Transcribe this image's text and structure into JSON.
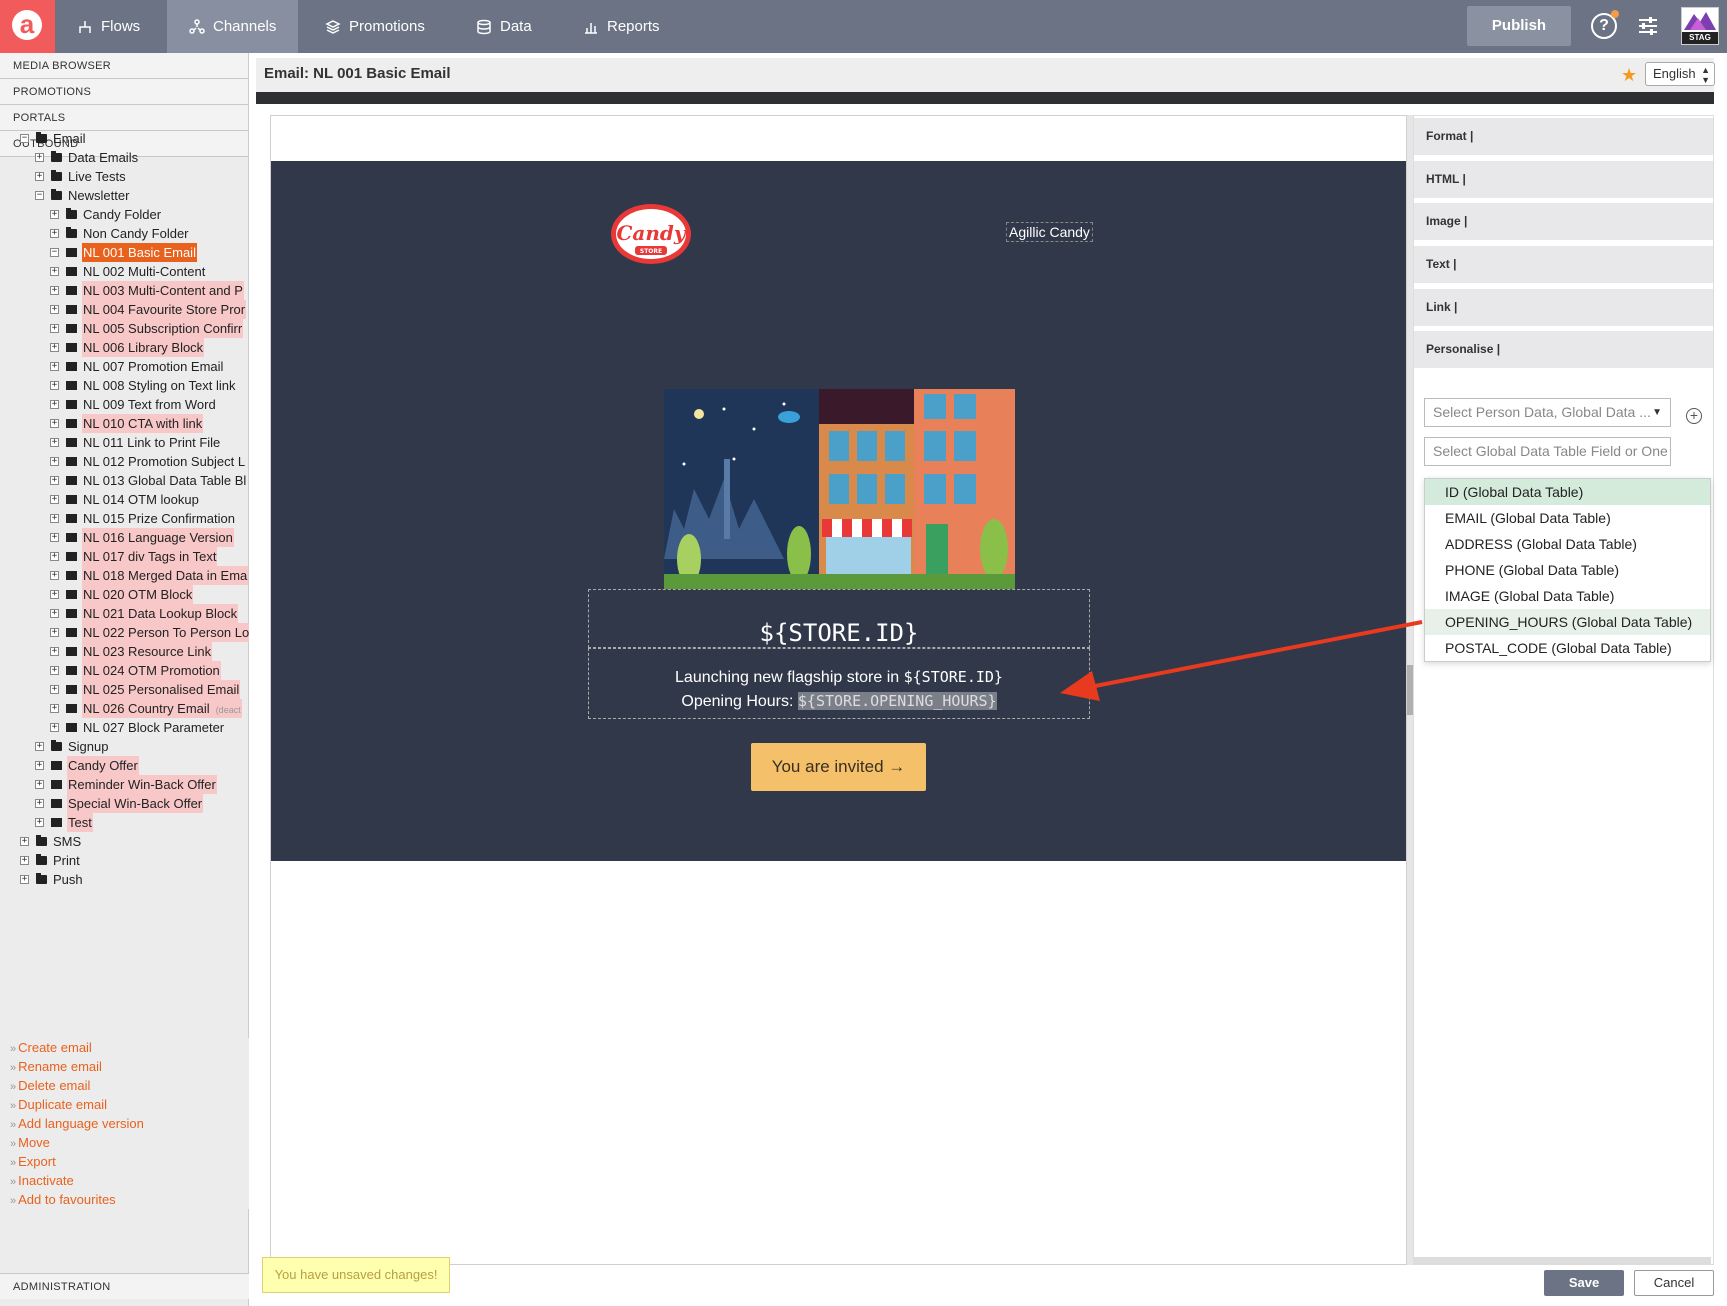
{
  "nav": {
    "items": [
      {
        "label": "Flows",
        "icon": "flows-icon"
      },
      {
        "label": "Channels",
        "icon": "channels-icon",
        "active": true
      },
      {
        "label": "Promotions",
        "icon": "promotions-icon"
      },
      {
        "label": "Data",
        "icon": "data-icon"
      },
      {
        "label": "Reports",
        "icon": "reports-icon"
      }
    ],
    "publish_label": "Publish",
    "help_label": "?",
    "env_label": "STAG"
  },
  "sidebar": {
    "sections": [
      "MEDIA BROWSER",
      "PROMOTIONS",
      "PORTALS",
      "OUTBOUND"
    ],
    "tree": [
      {
        "label": "Email",
        "level": 0,
        "type": "folder",
        "toggle": "−"
      },
      {
        "label": "Data Emails",
        "level": 1,
        "type": "folder",
        "toggle": "+"
      },
      {
        "label": "Live Tests",
        "level": 1,
        "type": "folder",
        "toggle": "+"
      },
      {
        "label": "Newsletter",
        "level": 1,
        "type": "folder",
        "toggle": "−"
      },
      {
        "label": "Candy Folder",
        "level": 2,
        "type": "folder",
        "toggle": "+"
      },
      {
        "label": "Non Candy Folder",
        "level": 2,
        "type": "folder",
        "toggle": "+"
      },
      {
        "label": "NL 001 Basic Email",
        "level": 2,
        "type": "mail",
        "toggle": "−",
        "state": "selected"
      },
      {
        "label": "NL 002 Multi-Content",
        "level": 2,
        "type": "mail",
        "toggle": "+"
      },
      {
        "label": "NL 003 Multi-Content and P",
        "level": 2,
        "type": "mail",
        "toggle": "+",
        "state": "pink"
      },
      {
        "label": "NL 004 Favourite Store Pror",
        "level": 2,
        "type": "mail",
        "toggle": "+",
        "state": "pink"
      },
      {
        "label": "NL 005 Subscription Confirr",
        "level": 2,
        "type": "mail",
        "toggle": "+",
        "state": "pink"
      },
      {
        "label": "NL 006 Library Block",
        "level": 2,
        "type": "mail",
        "toggle": "+",
        "state": "pink"
      },
      {
        "label": "NL 007 Promotion Email",
        "level": 2,
        "type": "mail",
        "toggle": "+"
      },
      {
        "label": "NL 008 Styling on Text link",
        "level": 2,
        "type": "mail",
        "toggle": "+"
      },
      {
        "label": "NL 009 Text from Word",
        "level": 2,
        "type": "mail",
        "toggle": "+"
      },
      {
        "label": "NL 010 CTA with link",
        "level": 2,
        "type": "mail",
        "toggle": "+",
        "state": "pink"
      },
      {
        "label": "NL 011 Link to Print File",
        "level": 2,
        "type": "mail",
        "toggle": "+"
      },
      {
        "label": "NL 012 Promotion Subject L",
        "level": 2,
        "type": "mail",
        "toggle": "+"
      },
      {
        "label": "NL 013 Global Data Table Bl",
        "level": 2,
        "type": "mail",
        "toggle": "+"
      },
      {
        "label": "NL 014 OTM lookup",
        "level": 2,
        "type": "mail",
        "toggle": "+"
      },
      {
        "label": "NL 015 Prize Confirmation",
        "level": 2,
        "type": "mail",
        "toggle": "+"
      },
      {
        "label": "NL 016 Language Version",
        "level": 2,
        "type": "mail",
        "toggle": "+",
        "state": "pink"
      },
      {
        "label": "NL 017 div Tags in Text",
        "level": 2,
        "type": "mail",
        "toggle": "+",
        "state": "pink"
      },
      {
        "label": "NL 018 Merged Data in Ema",
        "level": 2,
        "type": "mail",
        "toggle": "+",
        "state": "pink"
      },
      {
        "label": "NL 020 OTM Block",
        "level": 2,
        "type": "mail",
        "toggle": "+",
        "state": "pink"
      },
      {
        "label": "NL 021 Data Lookup Block",
        "level": 2,
        "type": "mail",
        "toggle": "+",
        "state": "pink"
      },
      {
        "label": "NL 022 Person To Person Lo",
        "level": 2,
        "type": "mail",
        "toggle": "+",
        "state": "pink"
      },
      {
        "label": "NL 023 Resource Link",
        "level": 2,
        "type": "mail",
        "toggle": "+",
        "state": "pink"
      },
      {
        "label": "NL 024 OTM Promotion",
        "level": 2,
        "type": "mail",
        "toggle": "+",
        "state": "pink"
      },
      {
        "label": "NL 025 Personalised Email",
        "level": 2,
        "type": "mail",
        "toggle": "+",
        "state": "pink"
      },
      {
        "label": "NL 026 Country Email",
        "level": 2,
        "type": "mail",
        "toggle": "+",
        "state": "pink",
        "suffix": "(deact"
      },
      {
        "label": "NL 027 Block Parameter",
        "level": 2,
        "type": "mail",
        "toggle": "+"
      },
      {
        "label": "Signup",
        "level": 1,
        "type": "folder",
        "toggle": "+"
      },
      {
        "label": "Candy Offer",
        "level": 1,
        "type": "mail",
        "toggle": "+",
        "state": "pink"
      },
      {
        "label": "Reminder Win-Back Offer",
        "level": 1,
        "type": "mail",
        "toggle": "+",
        "state": "pink"
      },
      {
        "label": "Special Win-Back Offer",
        "level": 1,
        "type": "mail",
        "toggle": "+",
        "state": "pink"
      },
      {
        "label": "Test",
        "level": 1,
        "type": "mail",
        "toggle": "+",
        "state": "pink"
      },
      {
        "label": "SMS",
        "level": 0,
        "type": "folder",
        "toggle": "+"
      },
      {
        "label": "Print",
        "level": 0,
        "type": "folder",
        "toggle": "+"
      },
      {
        "label": "Push",
        "level": 0,
        "type": "folder",
        "toggle": "+"
      }
    ],
    "actions": [
      "Create email",
      "Rename email",
      "Delete email",
      "Duplicate email",
      "Add language version",
      "Move",
      "Export",
      "Inactivate",
      "Add to favourites"
    ],
    "admin_label": "ADMINISTRATION"
  },
  "editor": {
    "title": "Email: NL 001 Basic Email",
    "language": "English",
    "brand_name": "Agillic Candy",
    "logo_text": "Candy",
    "logo_subtext": "STORE",
    "store_id": "${STORE.ID}",
    "line1_text": "Launching new flagship store in ",
    "line1_var": "${STORE.ID}",
    "line2_text": "Opening Hours: ",
    "line2_var": "${STORE.OPENING_HOURS}",
    "cta_label": "You are invited →",
    "unsaved_msg": "You have unsaved changes!",
    "save_label": "Save",
    "cancel_label": "Cancel"
  },
  "panel": {
    "sections": [
      "Format |",
      "HTML |",
      "Image |",
      "Text |",
      "Link |",
      "Personalise |"
    ],
    "select_placeholder": "Select Person Data, Global Data ...",
    "field_placeholder": "Select Global Data Table Field or One",
    "options": [
      {
        "label": "ID (Global Data Table)",
        "state": "selected"
      },
      {
        "label": "EMAIL (Global Data Table)"
      },
      {
        "label": "ADDRESS (Global Data Table)"
      },
      {
        "label": "PHONE (Global Data Table)"
      },
      {
        "label": "IMAGE (Global Data Table)"
      },
      {
        "label": "OPENING_HOURS (Global Data Table)",
        "state": "hover"
      },
      {
        "label": "POSTAL_CODE (Global Data Table)"
      }
    ]
  },
  "colors": {
    "accent": "#e8621e",
    "topbar": "#6b7384",
    "email_bg": "#303849",
    "cta": "#f5c06a",
    "arrow": "#e83a1e"
  }
}
